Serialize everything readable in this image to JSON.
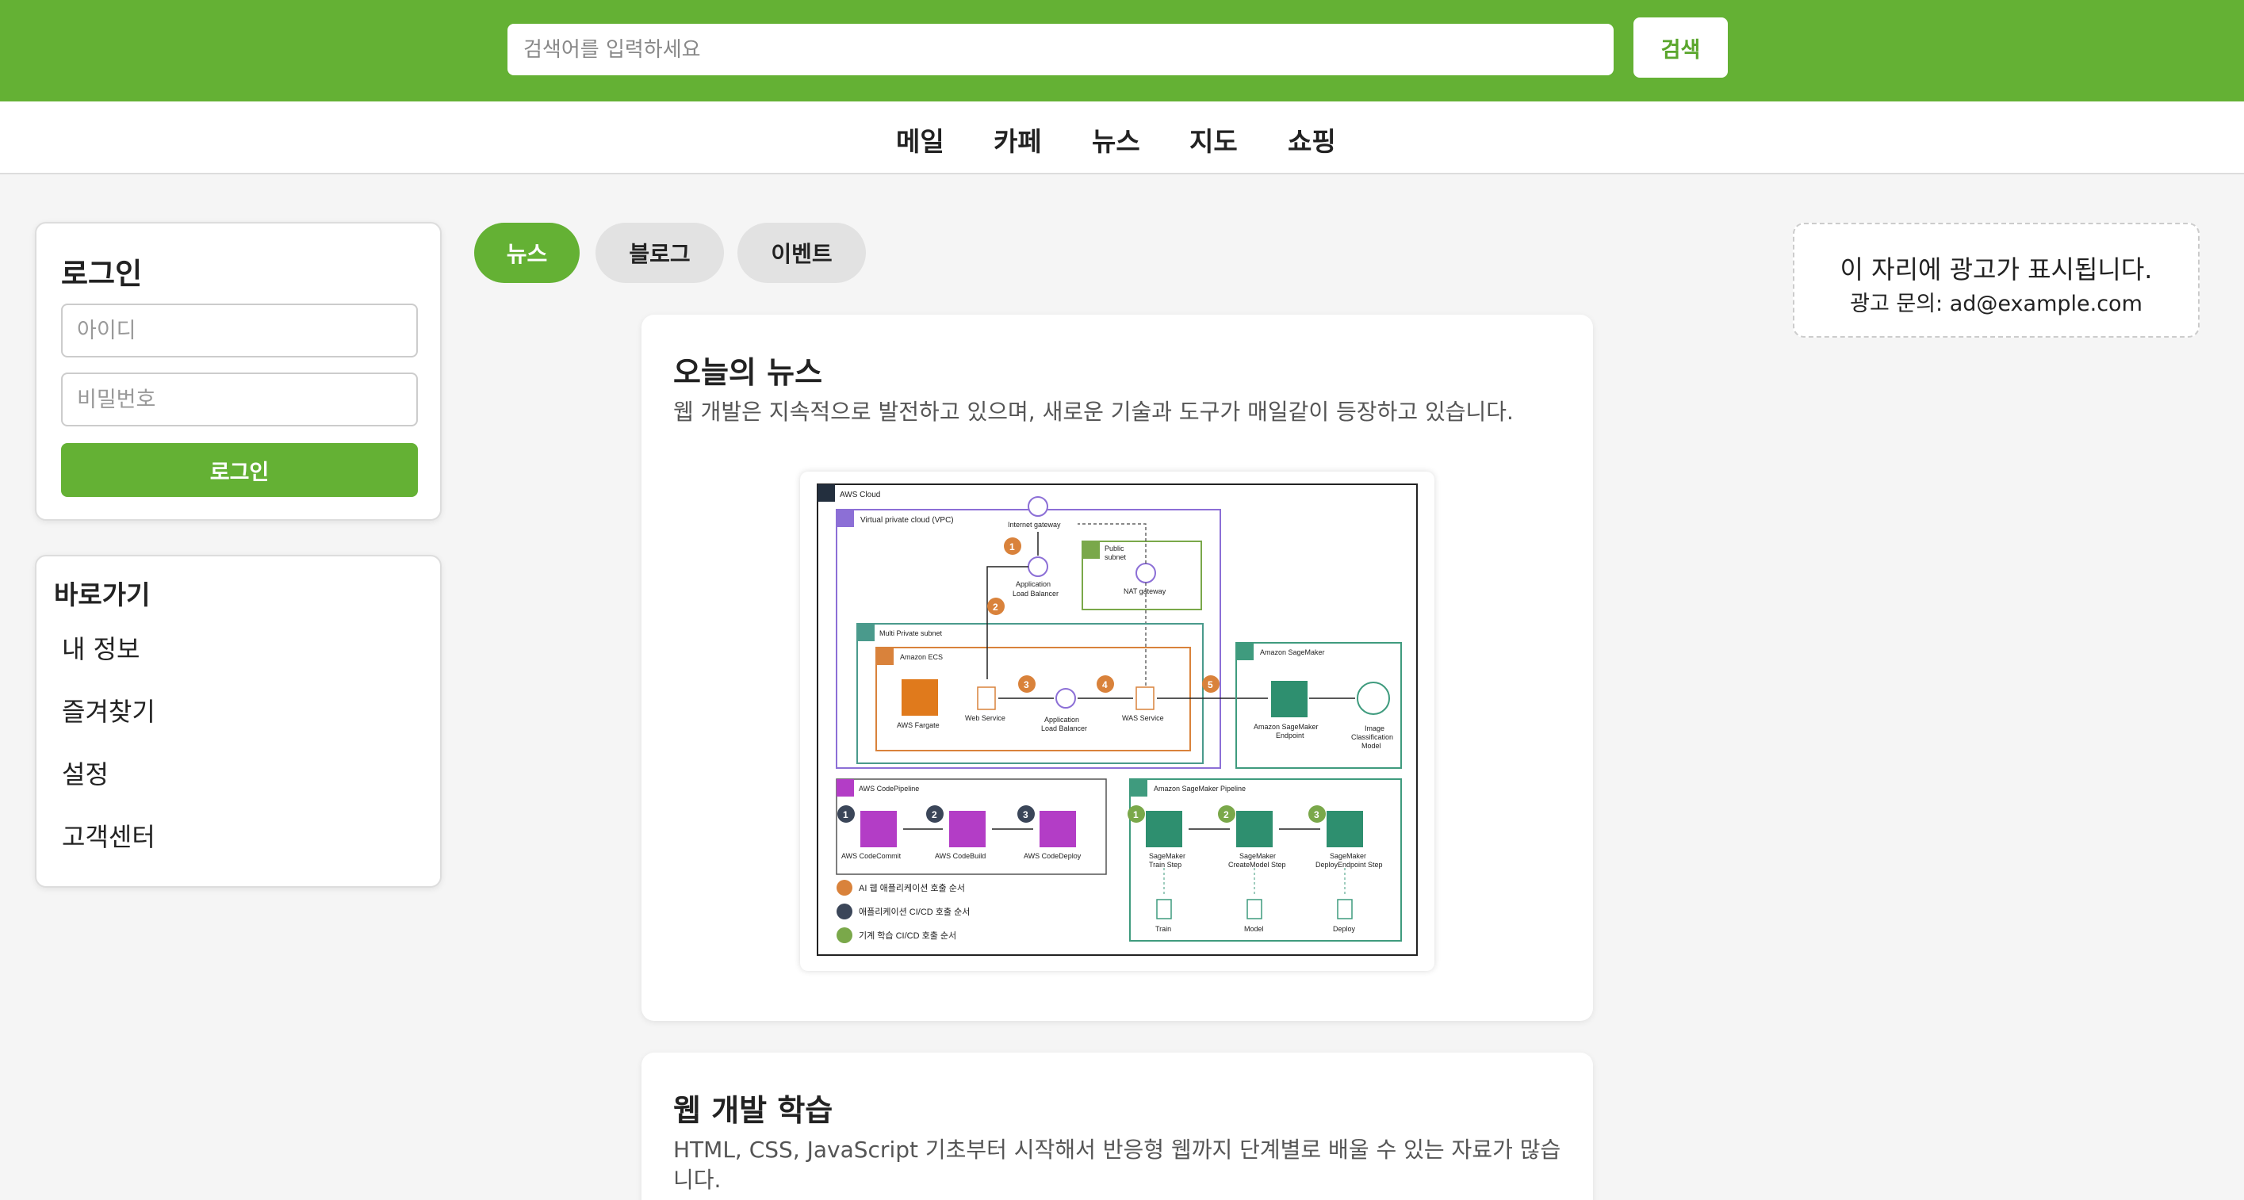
{
  "search": {
    "placeholder": "검색어를 입력하세요",
    "button": "검색"
  },
  "nav": {
    "items": [
      "메일",
      "카페",
      "뉴스",
      "지도",
      "쇼핑"
    ]
  },
  "login": {
    "title": "로그인",
    "id_placeholder": "아이디",
    "pw_placeholder": "비밀번호",
    "submit": "로그인"
  },
  "shortcuts": {
    "title": "바로가기",
    "items": [
      "내 정보",
      "즐겨찾기",
      "설정",
      "고객센터"
    ]
  },
  "tabs": [
    "뉴스",
    "블로그",
    "이벤트"
  ],
  "ad": {
    "line1": "이 자리에 광고가 표시됩니다.",
    "line2": "광고 문의: ad@example.com"
  },
  "cards": [
    {
      "title": "오늘의 뉴스",
      "body": "웹 개발은 지속적으로 발전하고 있으며, 새로운 기술과 도구가 매일같이 등장하고 있습니다."
    },
    {
      "title": "웹 개발 학습",
      "body": "HTML, CSS, JavaScript 기초부터 시작해서 반응형 웹까지 단계별로 배울 수 있는 자료가 많습니다."
    }
  ],
  "diagram": {
    "cloud": "AWS Cloud",
    "vpc": "Virtual private cloud (VPC)",
    "internet_gateway": "Internet gateway",
    "alb_top": [
      "Application",
      "Load Balancer"
    ],
    "public_subnet": [
      "Public",
      "subnet"
    ],
    "nat_gateway": "NAT gateway",
    "private_subnet": "Multi Private subnet",
    "ecs": "Amazon ECS",
    "fargate": "AWS Fargate",
    "web_service": "Web Service",
    "alb_mid": [
      "Application",
      "Load Balancer"
    ],
    "was_service": "WAS Service",
    "sagemaker": "Amazon SageMaker",
    "sm_endpoint": [
      "Amazon SageMaker",
      "Endpoint"
    ],
    "image_model": [
      "Image",
      "Classification",
      "Model"
    ],
    "codepipeline": "AWS CodePipeline",
    "codecommit": "AWS CodeCommit",
    "codebuild": "AWS CodeBuild",
    "codedeploy": "AWS CodeDeploy",
    "sm_pipeline": "Amazon SageMaker Pipeline",
    "train_step": [
      "SageMaker",
      "Train Step"
    ],
    "createmodel_step": [
      "SageMaker",
      "CreateModel Step"
    ],
    "deploy_step": [
      "SageMaker",
      "DeployEndpoint Step"
    ],
    "train": "Train",
    "model": "Model",
    "deploy": "Deploy",
    "legend": [
      "AI 웹 애플리케이션 호출 순서",
      "애플리케이션 CI/CD 호출 순서",
      "기계 학습 CI/CD 호출 순서"
    ],
    "steps_orange": [
      "1",
      "2",
      "3",
      "4",
      "5"
    ],
    "steps_dark": [
      "1",
      "2",
      "3"
    ],
    "steps_green": [
      "1",
      "2",
      "3"
    ],
    "colors": {
      "orange": "#d9823b",
      "dark": "#3b4659",
      "green": "#7aa84a",
      "purple": "#8c6fd6",
      "teal": "#4a9a8c",
      "magenta": "#b33dc6",
      "sagemaker": "#3f9b7e"
    }
  }
}
